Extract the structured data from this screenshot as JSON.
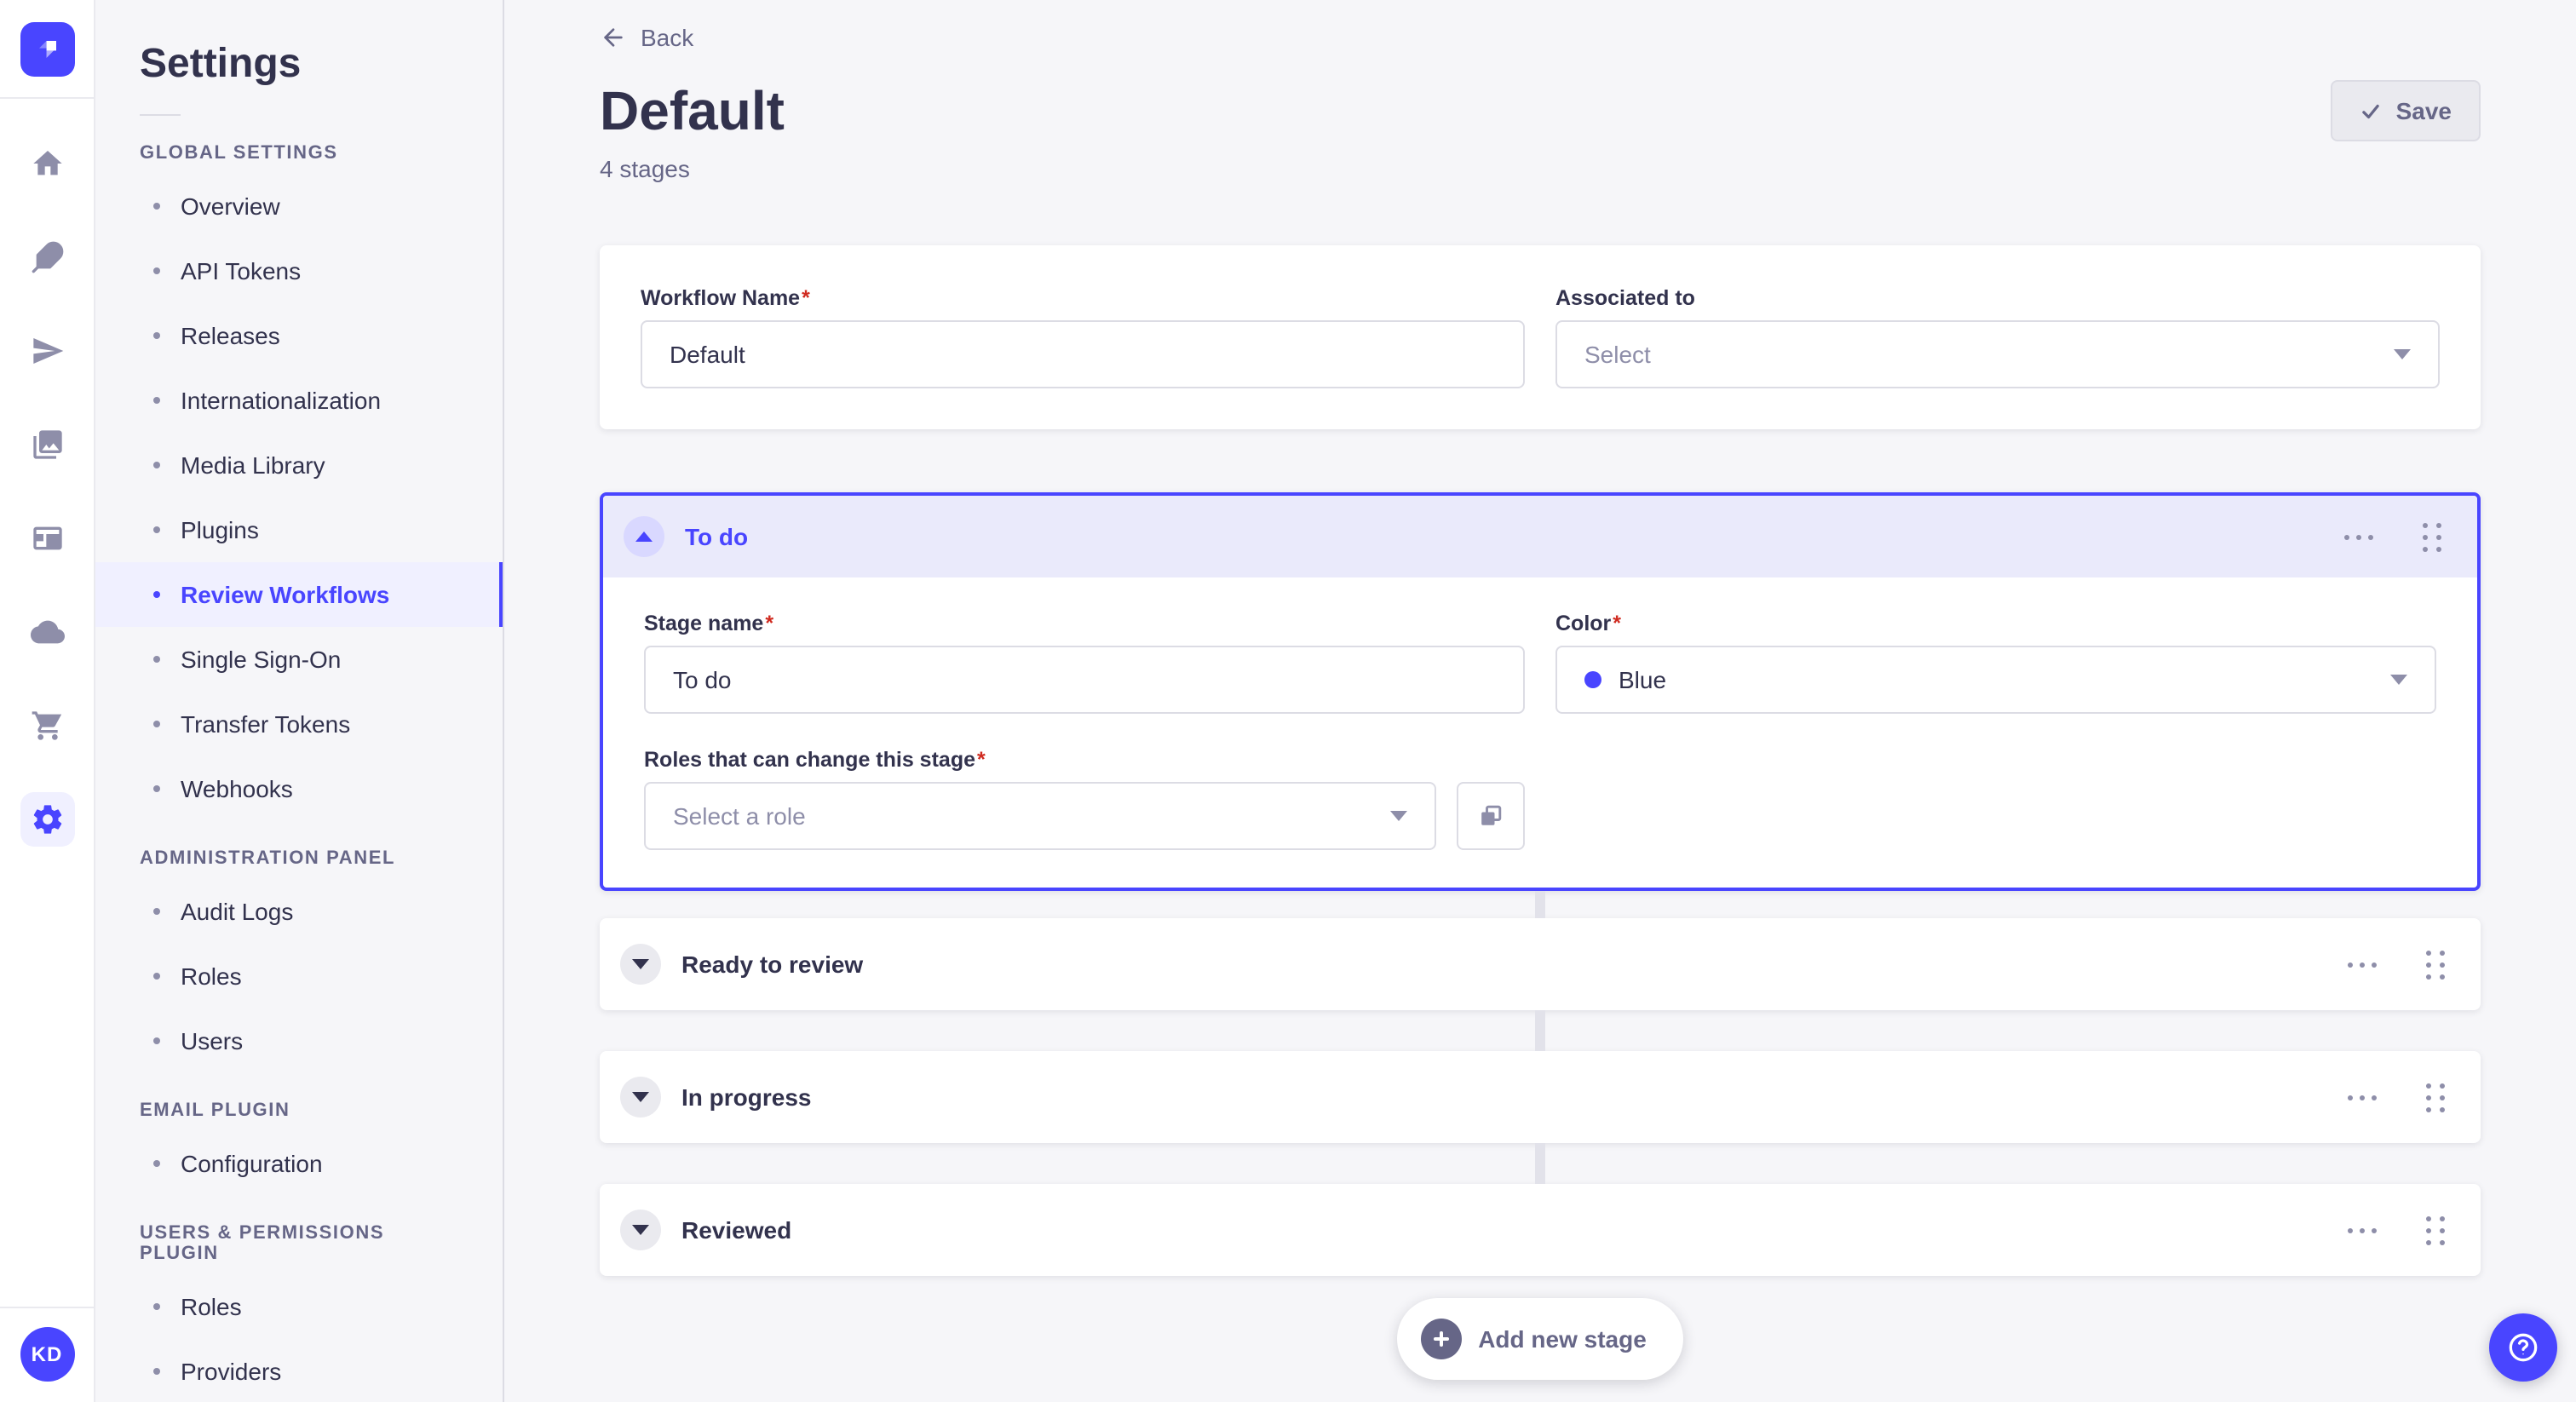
{
  "colors": {
    "primary": "#4945FF",
    "primary_light_bg": "#F0F0FF",
    "accordion_header_bg": "#EAEAFB",
    "expanded_chevron_circle": "#D9D8FF",
    "text_dark": "#32324D",
    "text_muted": "#666687",
    "text_subtle": "#8E8EA9",
    "border": "#DCDCE4",
    "page_bg": "#F6F6F9",
    "card_bg": "#FFFFFF",
    "required_red": "#D02B20",
    "save_disabled_bg": "#EAEAEF",
    "stage_color_dot": "#4945FF"
  },
  "rail": {
    "logo_icon": "strapi-logo",
    "icons": [
      {
        "name": "home-icon"
      },
      {
        "name": "feather-icon"
      },
      {
        "name": "paper-plane-icon"
      },
      {
        "name": "media-library-icon"
      },
      {
        "name": "layout-icon"
      },
      {
        "name": "cloud-icon"
      },
      {
        "name": "cart-icon"
      },
      {
        "name": "gear-icon",
        "active": true
      }
    ],
    "avatar_initials": "KD"
  },
  "settings_nav": {
    "title": "Settings",
    "sections": [
      {
        "label": "GLOBAL SETTINGS",
        "items": [
          {
            "label": "Overview"
          },
          {
            "label": "API Tokens"
          },
          {
            "label": "Releases"
          },
          {
            "label": "Internationalization"
          },
          {
            "label": "Media Library"
          },
          {
            "label": "Plugins"
          },
          {
            "label": "Review Workflows",
            "active": true
          },
          {
            "label": "Single Sign-On"
          },
          {
            "label": "Transfer Tokens"
          },
          {
            "label": "Webhooks"
          }
        ]
      },
      {
        "label": "ADMINISTRATION PANEL",
        "items": [
          {
            "label": "Audit Logs"
          },
          {
            "label": "Roles"
          },
          {
            "label": "Users"
          }
        ]
      },
      {
        "label": "EMAIL PLUGIN",
        "items": [
          {
            "label": "Configuration"
          }
        ]
      },
      {
        "label": "USERS & PERMISSIONS PLUGIN",
        "items": [
          {
            "label": "Roles"
          },
          {
            "label": "Providers"
          }
        ]
      }
    ]
  },
  "page": {
    "back_label": "Back",
    "title": "Default",
    "subtitle": "4 stages",
    "save_label": "Save",
    "required_mark": "*"
  },
  "workflow_card": {
    "name_label": "Workflow Name",
    "name_value": "Default",
    "associated_label": "Associated to",
    "associated_value": "Select"
  },
  "expanded_stage": {
    "title": "To do",
    "name_label": "Stage name",
    "name_value": "To do",
    "color_label": "Color",
    "color_value": "Blue",
    "roles_label": "Roles that can change this stage",
    "roles_placeholder": "Select a role",
    "duplicate_icon": "duplicate-icon",
    "more_icon": "ellipsis-icon",
    "drag_icon": "drag-handle-icon"
  },
  "collapsed_stages": [
    {
      "title": "Ready to review"
    },
    {
      "title": "In progress"
    },
    {
      "title": "Reviewed"
    }
  ],
  "add_stage_label": "Add new stage",
  "help_icon": "question-mark-icon"
}
